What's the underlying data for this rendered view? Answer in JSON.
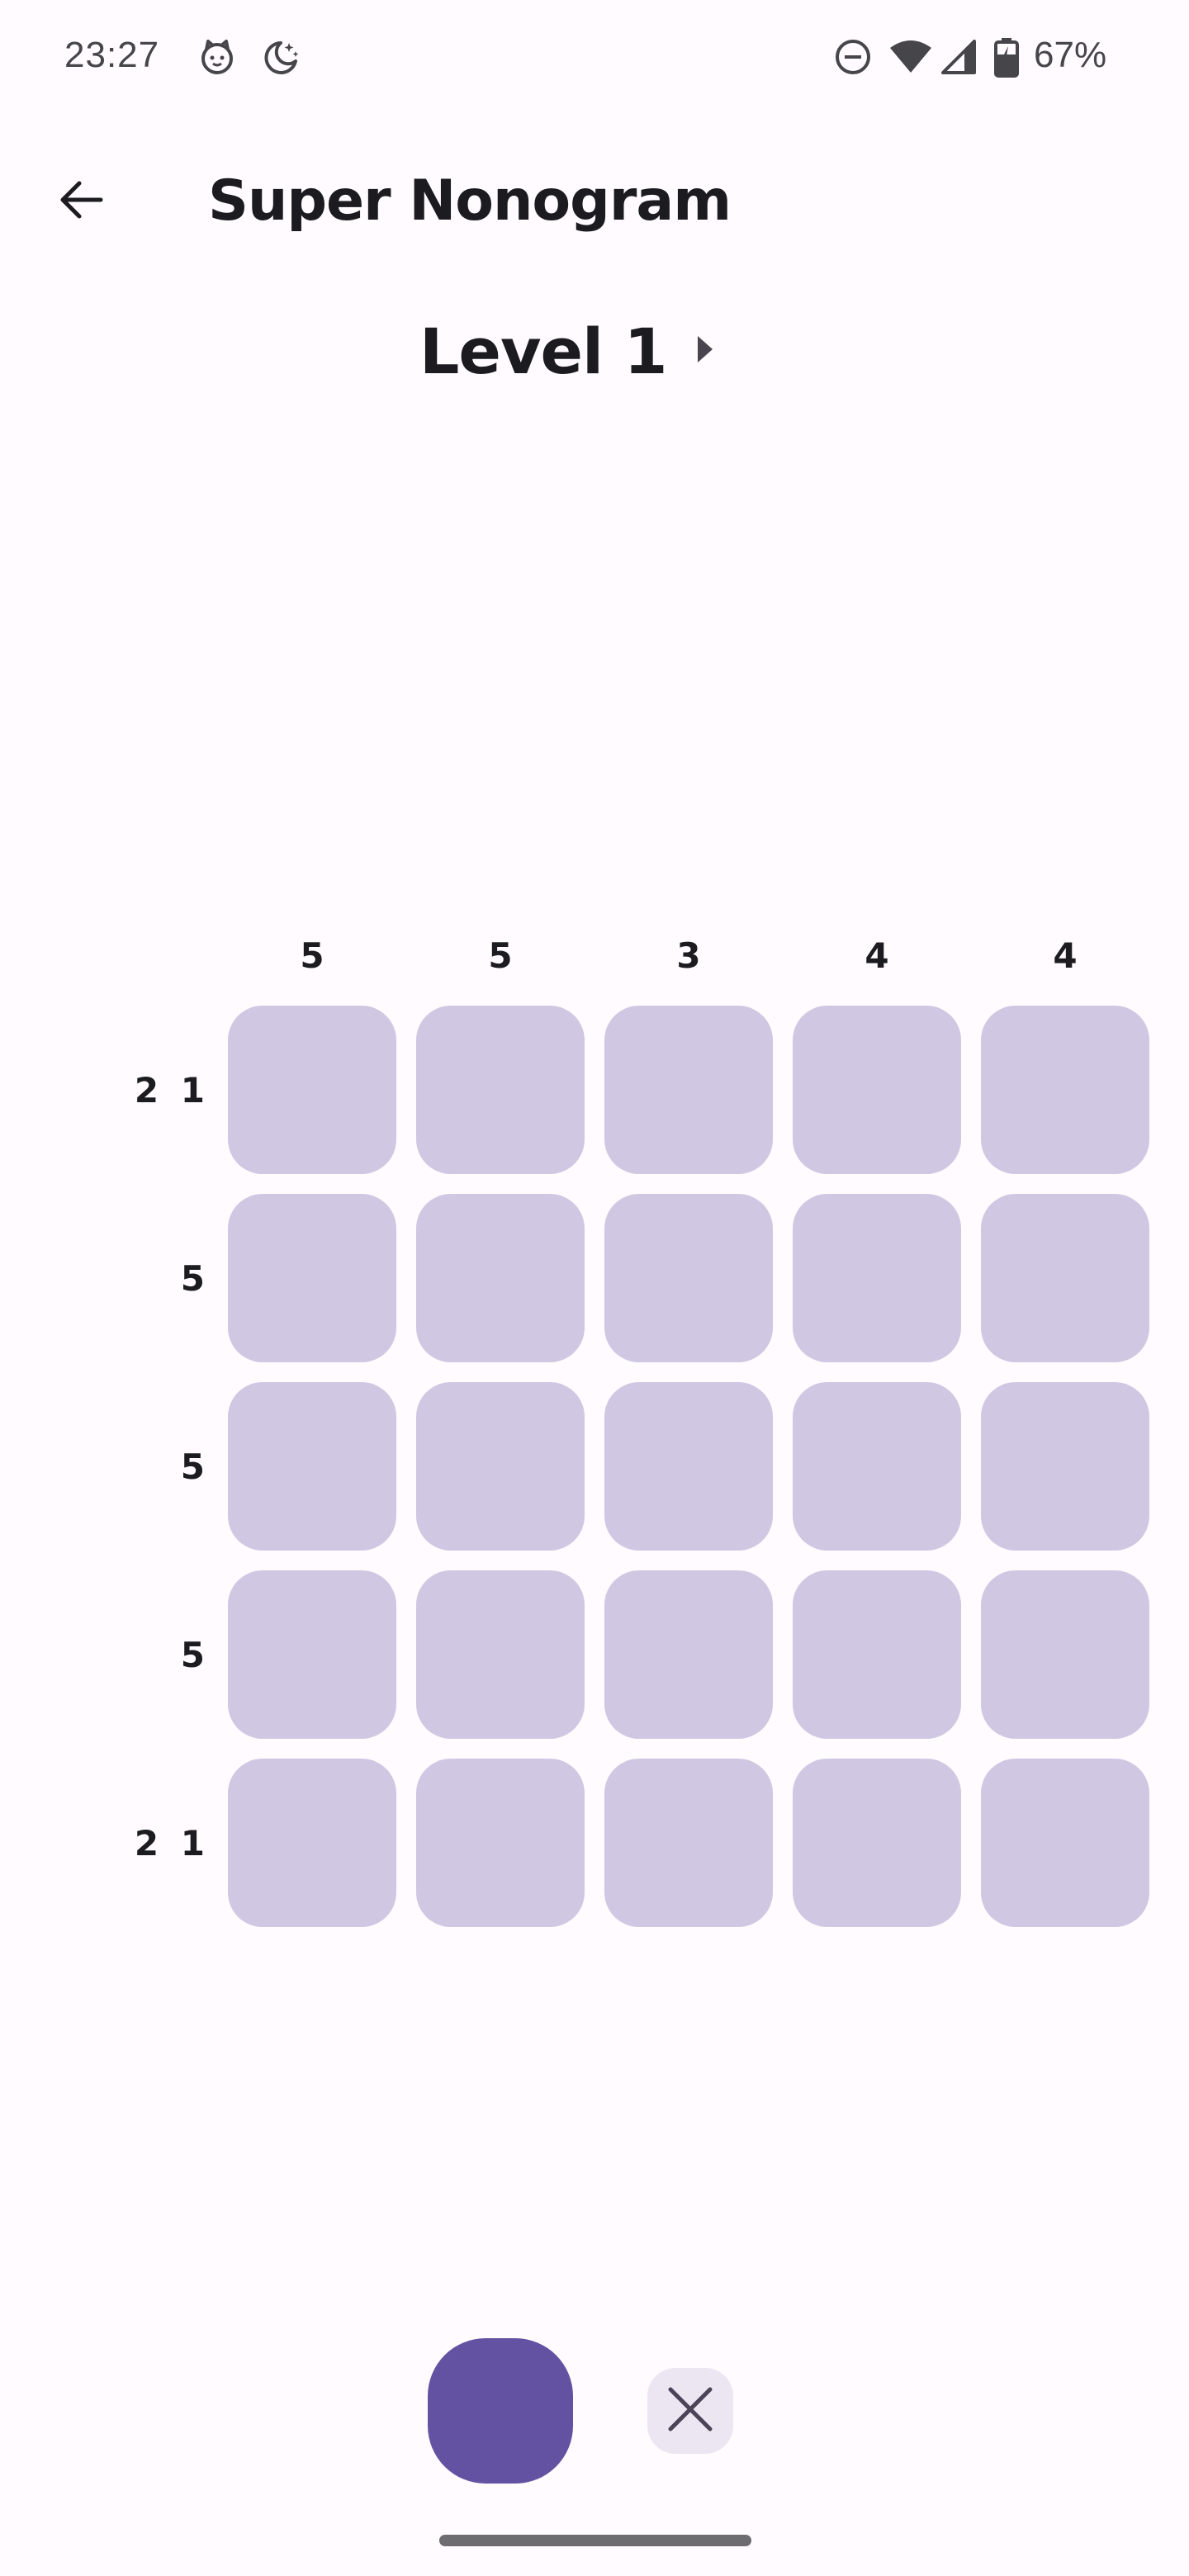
{
  "status_bar": {
    "time": "23:27",
    "left_icons": [
      "cat-face-icon",
      "moon-stars-icon"
    ],
    "right_icons": [
      "do-not-disturb-icon",
      "wifi-icon",
      "cell-signal-icon",
      "battery-charging-icon"
    ],
    "battery_percent": "67%"
  },
  "app_bar": {
    "back_icon": "arrow-back-icon",
    "title": "Super Nonogram"
  },
  "level": {
    "title": "Level 1",
    "next_icon": "play-arrow-icon"
  },
  "board": {
    "rows": 5,
    "cols": 5,
    "column_hints": [
      "5",
      "5",
      "3",
      "4",
      "4"
    ],
    "row_hints": [
      "2 1",
      "5",
      "5",
      "5",
      "2 1"
    ],
    "cell_color": "#d0c7e3",
    "filled_cells": 0
  },
  "controls": {
    "fill_mode_color": "#6352a1",
    "cross_mode_icon": "close-icon",
    "cross_mode_bg": "#ece6f3"
  }
}
